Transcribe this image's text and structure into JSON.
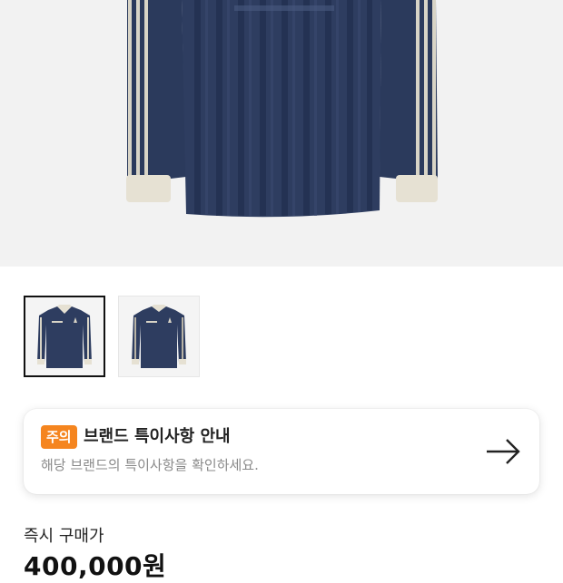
{
  "product": {
    "main_image_icon": "jersey-image",
    "thumbnails": [
      {
        "icon": "jersey-front-thumb",
        "selected": true
      },
      {
        "icon": "jersey-back-thumb",
        "selected": false
      }
    ]
  },
  "notice": {
    "badge": "주의",
    "title": "브랜드 특이사항 안내",
    "subtitle": "해당 브랜드의 특이사항을 확인하세요.",
    "arrow_icon": "arrow-right-icon",
    "badge_color": "#f5851f"
  },
  "price": {
    "label": "즉시 구매가",
    "value": "400,000원"
  }
}
